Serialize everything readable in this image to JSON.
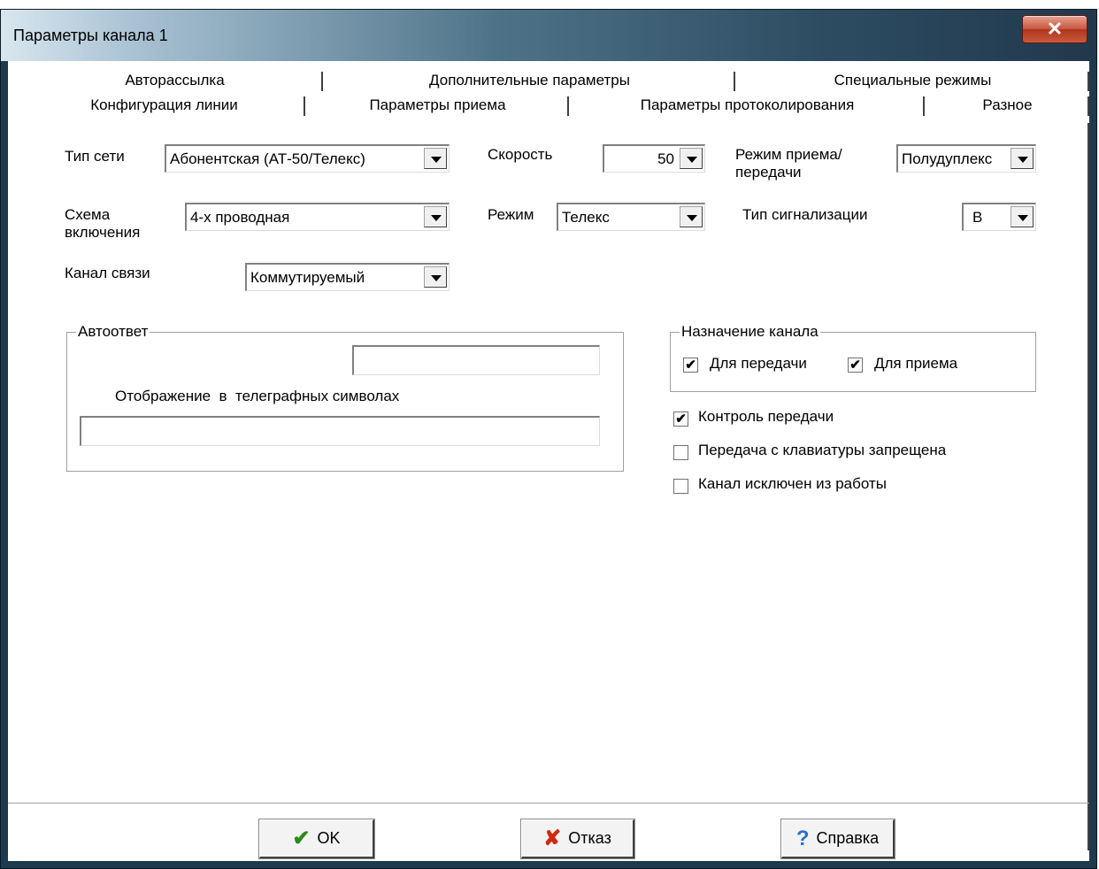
{
  "window": {
    "title": "Параметры канала 1",
    "close_label": "✕"
  },
  "tabs_back": [
    "Авторассылка",
    "Дополнительные параметры",
    "Специальные режимы"
  ],
  "tabs_front": [
    "Конфигурация линии",
    "Параметры приема",
    "Параметры протоколирования",
    "Разное"
  ],
  "fields": {
    "net_type": {
      "label": "Тип сети",
      "value": "Абонентская (АТ-50/Телекс)"
    },
    "speed": {
      "label": "Скорость",
      "value": "50"
    },
    "duplex": {
      "label": "Режим приема/передачи",
      "value": "Полудуплекс"
    },
    "scheme": {
      "label": "Схема включения",
      "value": "4-х проводная"
    },
    "mode": {
      "label": "Режим",
      "value": "Телекс"
    },
    "signal_type": {
      "label": "Тип сигнализации",
      "value": "В"
    },
    "channel": {
      "label": "Канал связи",
      "value": "Коммутируемый"
    }
  },
  "autoanswer": {
    "title": "Автоответ",
    "code_value": "",
    "telegraph_label": "Отображение  в  телеграфных символах",
    "telegraph_value": ""
  },
  "purpose": {
    "title": "Назначение канала",
    "send": {
      "label": "Для передачи",
      "checked": true
    },
    "receive": {
      "label": "Для приема",
      "checked": true
    }
  },
  "options": [
    {
      "label": "Контроль передачи",
      "checked": true
    },
    {
      "label": "Передача с клавиатуры запрещена",
      "checked": false
    },
    {
      "label": "Канал исключен из работы",
      "checked": false
    }
  ],
  "buttons": {
    "ok": {
      "label": "OK",
      "icon": "check-icon"
    },
    "cancel": {
      "label": "Отказ",
      "icon": "cross-icon"
    },
    "help": {
      "label": "Справка",
      "icon": "question-icon"
    }
  },
  "check_mark": "✔"
}
